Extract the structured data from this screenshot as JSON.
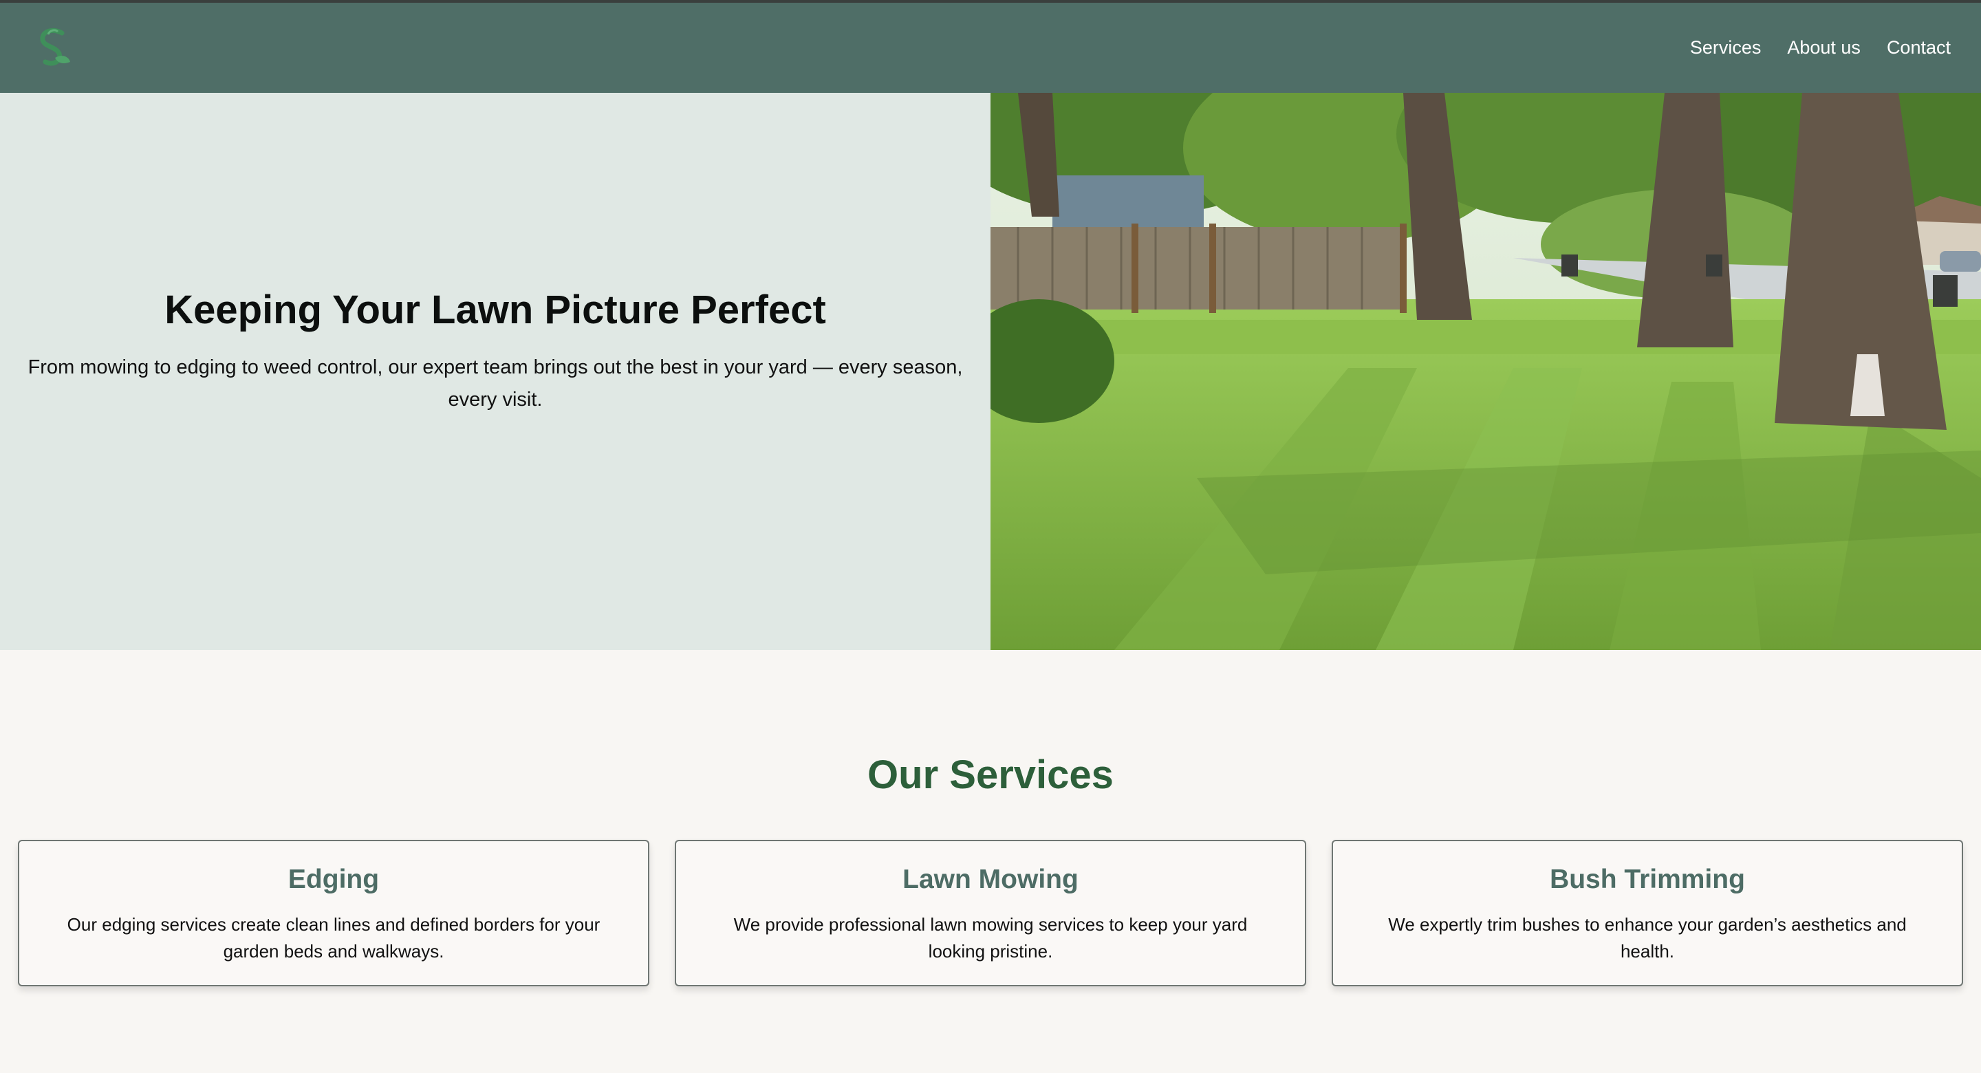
{
  "nav": {
    "logo_icon": "leaf-s-logo-icon",
    "links": [
      "Services",
      "About us",
      "Contact"
    ]
  },
  "hero": {
    "title": "Keeping Your Lawn Picture Perfect",
    "subtitle": "From mowing to edging to weed control, our expert team brings out the best in your yard — every season, every visit.",
    "image": "lawn-photo"
  },
  "services": {
    "heading": "Our Services",
    "cards": [
      {
        "title": "Edging",
        "description": "Our edging services create clean lines and defined borders for your garden beds and walkways."
      },
      {
        "title": "Lawn Mowing",
        "description": "We provide professional lawn mowing services to keep your yard looking pristine."
      },
      {
        "title": "Bush Trimming",
        "description": "We expertly trim bushes to enhance your garden’s aesthetics and health."
      }
    ]
  },
  "colors": {
    "navbar": "#4f6e67",
    "hero_left_bg": "#e0e8e4",
    "services_heading": "#2d5f3a",
    "card_title": "#4d6c65",
    "page_bg": "#f8f6f3"
  }
}
